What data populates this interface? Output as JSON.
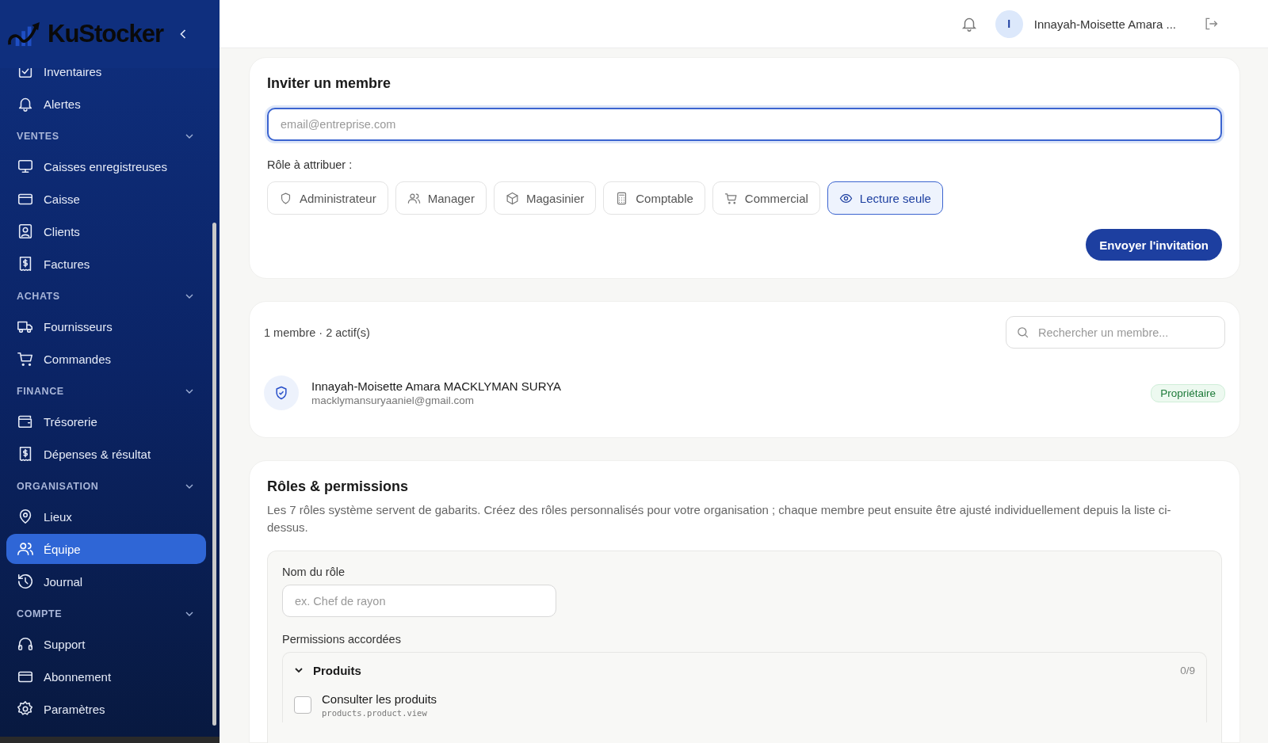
{
  "sidebar": {
    "logo": "KuStocker",
    "items": [
      {
        "kind": "link",
        "label": "Inventaires",
        "selected": false
      },
      {
        "kind": "link",
        "label": "Alertes",
        "selected": false
      },
      {
        "kind": "section",
        "label": "VENTES",
        "expanded": true
      },
      {
        "kind": "link",
        "label": "Caisses enregistreuses",
        "selected": false
      },
      {
        "kind": "link",
        "label": "Caisse",
        "selected": false
      },
      {
        "kind": "link",
        "label": "Clients",
        "selected": false
      },
      {
        "kind": "link",
        "label": "Factures",
        "selected": false
      },
      {
        "kind": "section",
        "label": "ACHATS",
        "expanded": true
      },
      {
        "kind": "link",
        "label": "Fournisseurs",
        "selected": false
      },
      {
        "kind": "link",
        "label": "Commandes",
        "selected": false
      },
      {
        "kind": "section",
        "label": "FINANCE",
        "expanded": true
      },
      {
        "kind": "link",
        "label": "Trésorerie",
        "selected": false
      },
      {
        "kind": "link",
        "label": "Dépenses & résultat",
        "selected": false
      },
      {
        "kind": "section",
        "label": "ORGANISATION",
        "expanded": true
      },
      {
        "kind": "link",
        "label": "Lieux",
        "selected": false
      },
      {
        "kind": "link",
        "label": "Équipe",
        "selected": true
      },
      {
        "kind": "link",
        "label": "Journal",
        "selected": false
      },
      {
        "kind": "section",
        "label": "COMPTE",
        "expanded": true
      },
      {
        "kind": "link",
        "label": "Support",
        "selected": false
      },
      {
        "kind": "link",
        "label": "Abonnement",
        "selected": false
      },
      {
        "kind": "link",
        "label": "Paramètres",
        "selected": false
      }
    ]
  },
  "header": {
    "avatar_initial": "I",
    "user_name": "Innayah-Moisette Amara ..."
  },
  "invite": {
    "title": "Inviter un membre",
    "email": {
      "placeholder": "email@entreprise.com"
    },
    "role_label": "Rôle à attribuer :",
    "roles": [
      {
        "label": "Administrateur",
        "selected": false
      },
      {
        "label": "Manager",
        "selected": false
      },
      {
        "label": "Magasinier",
        "selected": false
      },
      {
        "label": "Comptable",
        "selected": false
      },
      {
        "label": "Commercial",
        "selected": false
      },
      {
        "label": "Lecture seule",
        "selected": true
      }
    ],
    "submit": "Envoyer l'invitation"
  },
  "members": {
    "summary": "1 membre · 2 actif(s)",
    "search": {
      "placeholder": "Rechercher un membre..."
    },
    "list": [
      {
        "name": "Innayah-Moisette Amara MACKLYMAN SURYA",
        "email": "macklymansuryaaniel@gmail.com",
        "badge": "Propriétaire"
      }
    ]
  },
  "roles_section": {
    "title": "Rôles & permissions",
    "description": "Les 7 rôles système servent de gabarits. Créez des rôles personnalisés pour votre organisation ; chaque membre peut ensuite être ajusté individuellement depuis la liste ci-dessus.",
    "name_label": "Nom du rôle",
    "name_field": {
      "placeholder": "ex. Chef de rayon"
    },
    "permissions_label": "Permissions accordées",
    "groups": [
      {
        "name": "Produits",
        "expanded": true,
        "count": "0/9",
        "items": [
          {
            "label": "Consulter les produits",
            "code": "products.product.view",
            "checked": false
          }
        ]
      }
    ]
  }
}
